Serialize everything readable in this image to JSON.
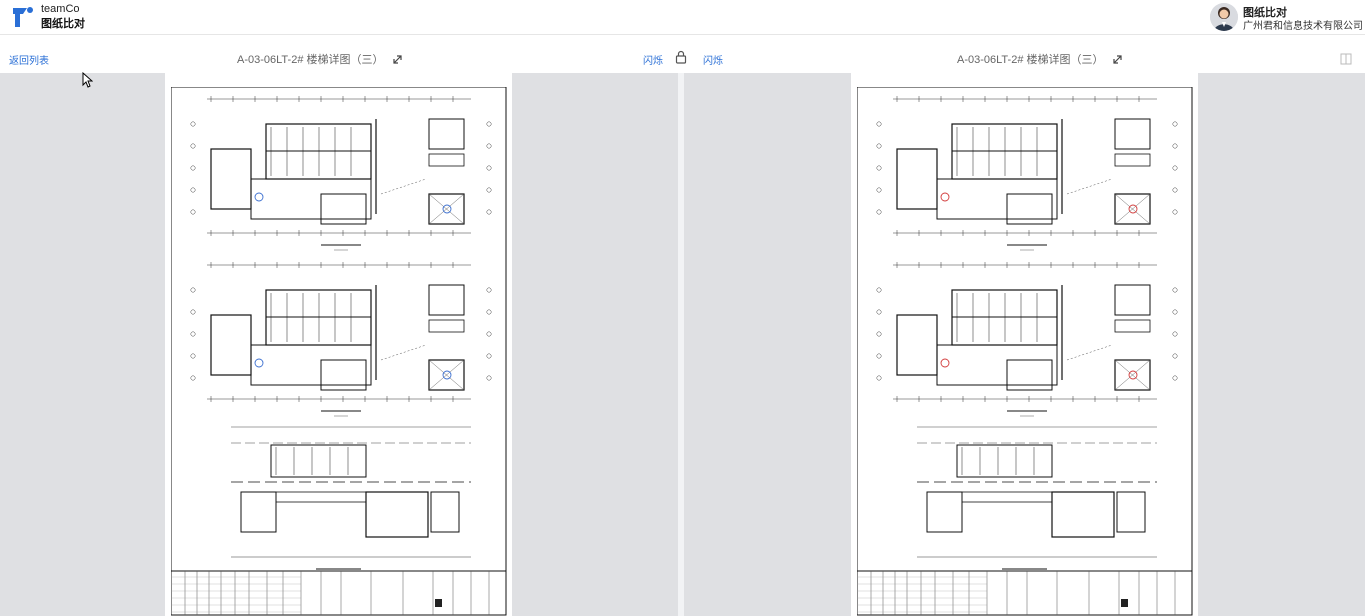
{
  "header": {
    "logo_line1": "teamCo",
    "logo_line2": "图纸比对",
    "user_name": "图纸比对",
    "user_org": "广州君和信息技术有限公司"
  },
  "toolbar": {
    "back_label": "返回列表",
    "left_title": "A-03-06LT-2# 楼梯详图（三）",
    "right_title": "A-03-06LT-2# 楼梯详图（三）",
    "flash_left_label": "闪烁",
    "flash_right_label": "闪烁"
  },
  "colors": {
    "accent": "#2a6fd6",
    "diff_left": "#3a6ecf",
    "diff_right": "#d23a3a"
  },
  "icons": [
    "expand-icon",
    "lock-icon",
    "compare-icon"
  ]
}
